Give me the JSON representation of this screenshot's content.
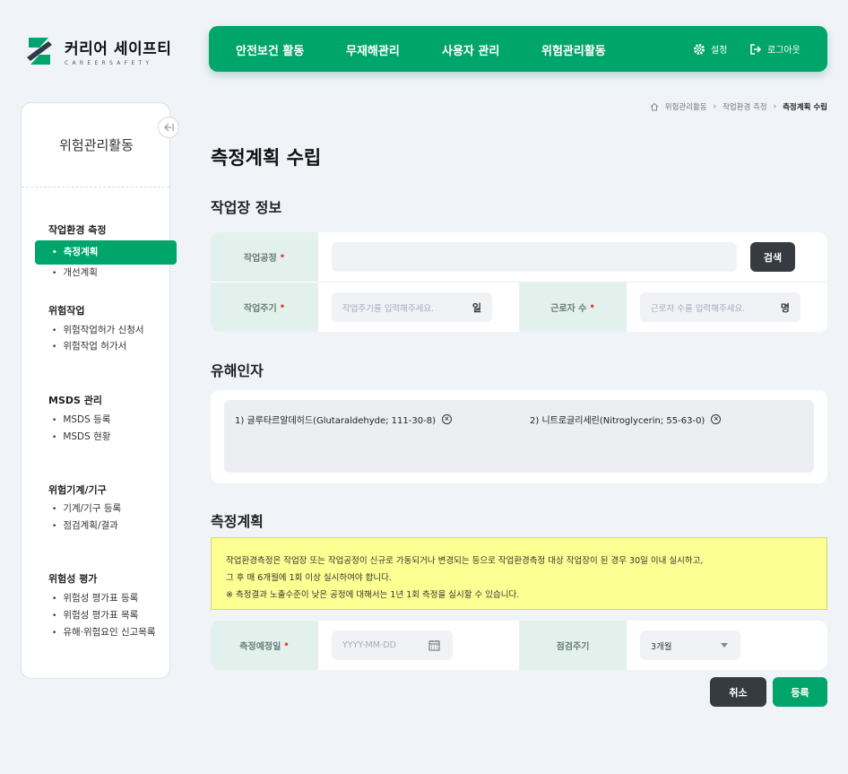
{
  "brand": {
    "title": "커리어 세이프티",
    "subtitle": "CAREERSAFETY"
  },
  "topnav": {
    "items": [
      "안전보건 활동",
      "무재해관리",
      "사용자 관리",
      "위험관리활동"
    ],
    "settings": "설정",
    "logout": "로그아웃"
  },
  "sidebar": {
    "title": "위험관리활동",
    "groups": [
      {
        "title": "작업환경 측정",
        "items": [
          "측정계획",
          "개선계획"
        ]
      },
      {
        "title": "위험작업",
        "items": [
          "위험작업허가 신청서",
          "위험작업 허가서"
        ]
      },
      {
        "title": "MSDS 관리",
        "items": [
          "MSDS 등록",
          "MSDS 현황"
        ]
      },
      {
        "title": "위험기계/기구",
        "items": [
          "기계/기구 등록",
          "점검계획/결과"
        ]
      },
      {
        "title": "위험성 평가",
        "items": [
          "위험성 평가표 등록",
          "위험성 평가표 목록",
          "유해·위험요인 신고목록"
        ]
      }
    ]
  },
  "breadcrumb": [
    "위험관리활동",
    "작업환경 측정",
    "측정계획 수립"
  ],
  "page_title": "측정계획 수립",
  "workplace": {
    "section_title": "작업장 정보",
    "process_label": "작업공정",
    "process_value": "",
    "search_button": "검색",
    "cycle_label": "작업주기",
    "cycle_placeholder": "작업주기를 입력해주세요.",
    "cycle_unit": "일",
    "workers_label": "근로자 수",
    "workers_placeholder": "근로자 수를 입력해주세요.",
    "workers_unit": "명"
  },
  "hazards": {
    "section_title": "유해인자",
    "items": [
      "1) 글루타르알데히드(Glutaraldehyde; 111-30-8)",
      "2) 니트로글리세린(Nitroglycerin; 55-63-0)"
    ]
  },
  "plan": {
    "section_title": "측정계획",
    "notice": [
      "작업환경측정은 작업장 또는 작업공정이 신규로 가동되거나 변경되는 등으로 작업환경측정 대상 작업장이 된 경우 30일 이내 실시하고,",
      "그 후 매 6개월에 1회 이상 실시하여야 합니다.",
      "※ 측정결과 노출수준이 낮은 공정에 대해서는 1년 1회 측정을 실시할 수 있습니다."
    ],
    "date_label": "측정예정일",
    "date_placeholder": "YYYY-MM-DD",
    "cycle_label": "점검주기",
    "cycle_value": "3개월"
  },
  "actions": {
    "cancel": "취소",
    "submit": "등록"
  },
  "colors": {
    "accent": "#00a56c",
    "dark_button": "#363b42",
    "notice_bg": "#fcff92",
    "label_bg": "#e3f1ec"
  }
}
